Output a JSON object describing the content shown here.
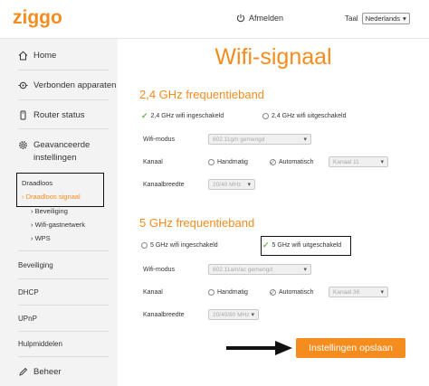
{
  "header": {
    "logo": "ziggo",
    "logout_label": "Afmelden",
    "language_label": "Taal",
    "language_value": "Nederlands"
  },
  "sidebar": {
    "home": "Home",
    "connected": "Verbonden apparaten",
    "router_status": "Router status",
    "advanced_line1": "Geavanceerde",
    "advanced_line2": "instellingen",
    "wireless": "Draadloos",
    "wireless_signal": "Draadloos signaal",
    "security_sub": "Beveiliging",
    "guest_network": "Wifi-gastnetwerk",
    "wps": "WPS",
    "security": "Beveiliging",
    "dhcp": "DHCP",
    "upnp": "UPnP",
    "tools": "Hulpmiddelen",
    "manage": "Beheer"
  },
  "main": {
    "title": "Wifi-signaal",
    "band24": {
      "heading": "2,4 GHz frequentieband",
      "on_label": "2,4 GHz wifi ingeschakeld",
      "off_label": "2,4 GHz wifi uitgeschakeld",
      "mode_label": "Wifi-modus",
      "mode_value": "802.11g/n gemengd",
      "channel_label": "Kanaal",
      "manual_label": "Handmatig",
      "auto_label": "Automatisch",
      "channel_value": "Kanaal 11",
      "bandwidth_label": "Kanaalbreedte",
      "bandwidth_value": "20/40 MHz"
    },
    "band5": {
      "heading": "5 GHz frequentieband",
      "on_label": "5 GHz wifi ingeschakeld",
      "off_label": "5 GHz wifi uitgeschakeld",
      "mode_label": "Wifi-modus",
      "mode_value": "802.11a/n/ac gemengd",
      "channel_label": "Kanaal",
      "manual_label": "Handmatig",
      "auto_label": "Automatisch",
      "channel_value": "Kanaal 36",
      "bandwidth_label": "Kanaalbreedte",
      "bandwidth_value": "20/40/80 MHz"
    },
    "save_label": "Instellingen opslaan"
  },
  "colors": {
    "accent": "#f48c1e",
    "check": "#6ab446",
    "sidebar_bg": "#f3f3f3"
  },
  "icons": [
    "power-icon",
    "home-icon",
    "devices-icon",
    "router-icon",
    "gear-icon",
    "pencil-icon",
    "check-icon",
    "arrow-icon",
    "chevron-down-icon"
  ]
}
